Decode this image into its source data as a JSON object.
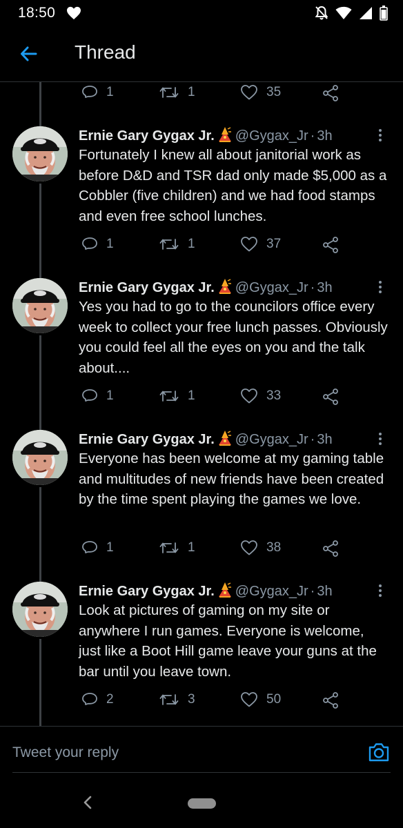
{
  "status_bar": {
    "time": "18:50"
  },
  "header": {
    "title": "Thread"
  },
  "top_actions": {
    "replies": "1",
    "retweets": "1",
    "likes": "35"
  },
  "tweets": [
    {
      "name": "Ernie Gary Gygax Jr.",
      "handle": "@Gygax_Jr",
      "sep": "·",
      "time": "3h",
      "text": "Fortunately I knew all about janitorial work as before D&D and TSR dad only made $5,000 as a Cobbler (five children) and we had food stamps and even free school lunches.",
      "replies": "1",
      "retweets": "1",
      "likes": "37"
    },
    {
      "name": "Ernie Gary Gygax Jr.",
      "handle": "@Gygax_Jr",
      "sep": "·",
      "time": "3h",
      "text": "Yes you had to go to the councilors office every week to collect your free lunch passes. Obviously you could feel all the eyes on you and the talk about....",
      "replies": "1",
      "retweets": "1",
      "likes": "33"
    },
    {
      "name": "Ernie Gary Gygax Jr.",
      "handle": "@Gygax_Jr",
      "sep": "·",
      "time": "3h",
      "text": "Everyone has been welcome at my gaming table and multitudes of new friends have been created by the time spent playing the games we love.",
      "replies": "1",
      "retweets": "1",
      "likes": "38"
    },
    {
      "name": "Ernie Gary Gygax Jr.",
      "handle": "@Gygax_Jr",
      "sep": "·",
      "time": "3h",
      "text": "Look at pictures of gaming on my site or anywhere I run games. Everyone is welcome, just like a Boot Hill game leave your guns at the bar until you leave town.",
      "replies": "2",
      "retweets": "3",
      "likes": "50"
    }
  ],
  "reply": {
    "placeholder": "Tweet your reply"
  },
  "colors": {
    "accent": "#1d9bf0",
    "muted": "#8b98a5",
    "background": "#000000"
  }
}
